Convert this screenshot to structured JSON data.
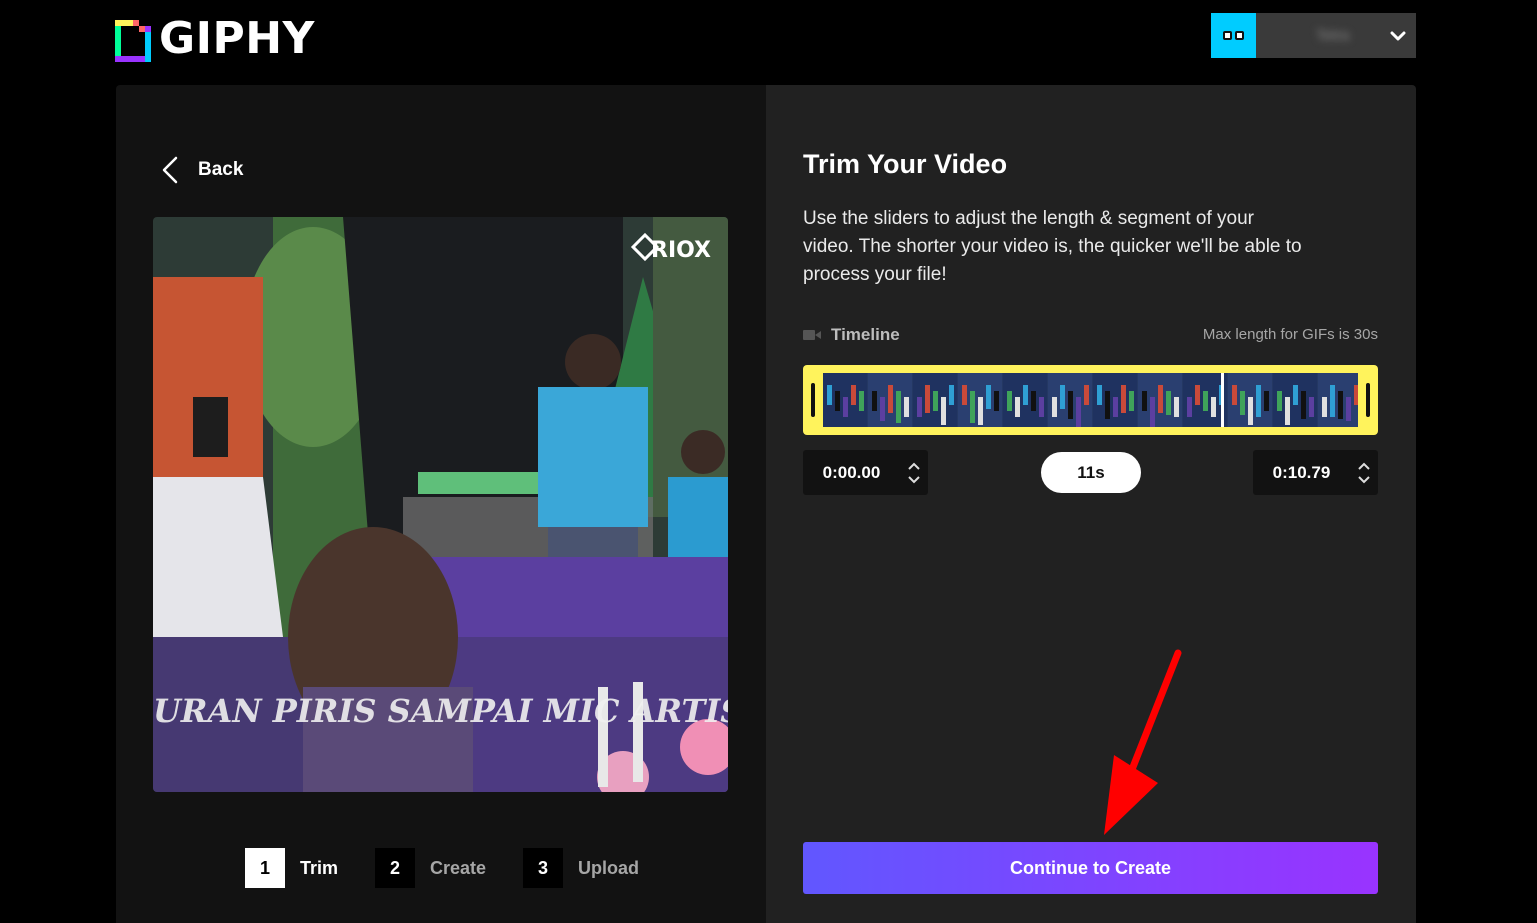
{
  "header": {
    "logo_text": "GIPHY",
    "username": "Tetra"
  },
  "left": {
    "back_label": "Back",
    "video": {
      "watermark": "RIOX",
      "caption": "URAN PIRIS SAMPAI MIC ARTIS"
    },
    "steps": [
      {
        "number": "1",
        "label": "Trim",
        "active": true
      },
      {
        "number": "2",
        "label": "Create",
        "active": false
      },
      {
        "number": "3",
        "label": "Upload",
        "active": false
      }
    ]
  },
  "right": {
    "title": "Trim Your Video",
    "description": "Use the sliders to adjust the length & segment of your video. The shorter your video is, the quicker we'll be able to process your file!",
    "timeline_label": "Timeline",
    "max_length": "Max length for GIFs is 30s",
    "start_time": "0:00.00",
    "duration": "11s",
    "end_time": "0:10.79",
    "continue_label": "Continue to Create"
  },
  "colors": {
    "accent_gradient_start": "#6157ff",
    "accent_gradient_end": "#9933ff",
    "timeline_frame": "#fff35c",
    "avatar_bg": "#00ccff",
    "annotation_arrow": "#ff0000"
  },
  "icons": {
    "logo": "giphy-logo-icon",
    "dropdown": "chevron-down-icon",
    "back": "chevron-left-icon",
    "timeline": "video-camera-icon",
    "spin_up": "chevron-up-icon",
    "spin_down": "chevron-down-icon"
  }
}
